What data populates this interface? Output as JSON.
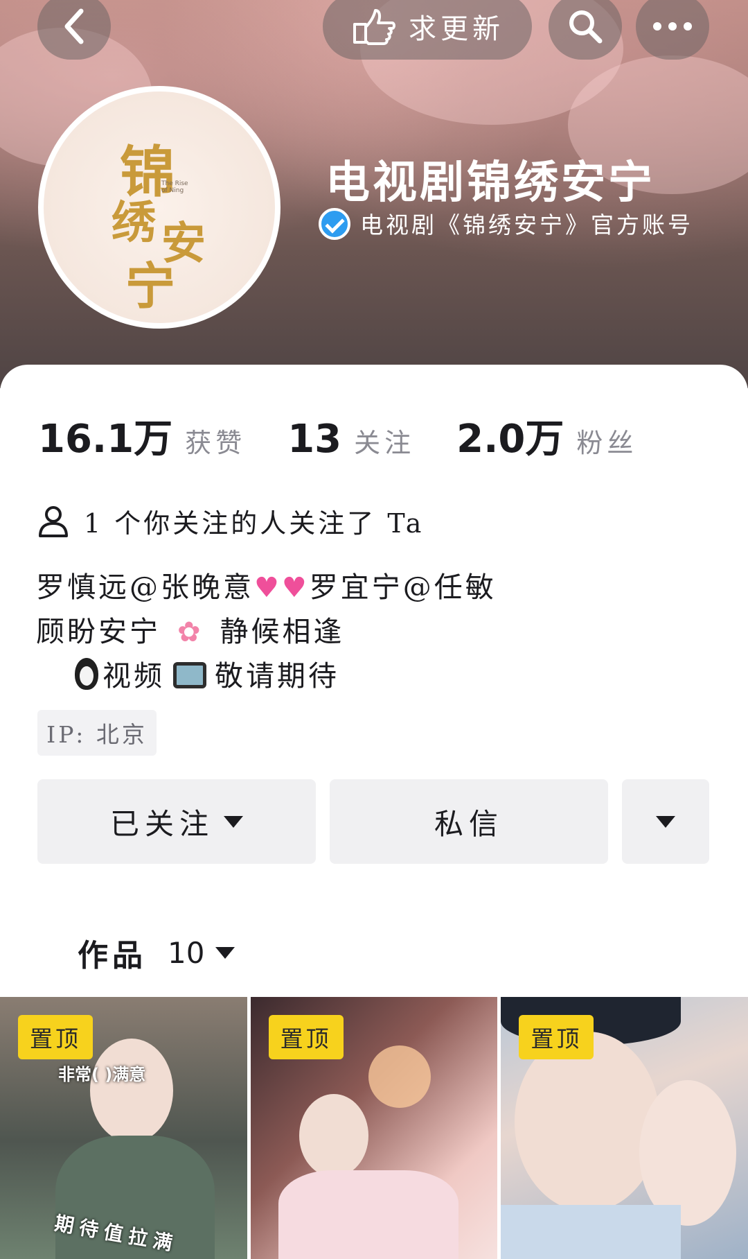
{
  "header": {
    "back_label": "‹",
    "update_label": "求更新",
    "search_label": "search",
    "more_label": "•••"
  },
  "profile": {
    "avatar_text": [
      "锦",
      "绣",
      "安",
      "宁"
    ],
    "avatar_caption": "The Rise of Ning",
    "name": "电视剧锦绣安宁",
    "verified_text": "电视剧《锦绣安宁》官方账号"
  },
  "stats": [
    {
      "value": "16.1万",
      "label": "获赞"
    },
    {
      "value": "13",
      "label": "关注"
    },
    {
      "value": "2.0万",
      "label": "粉丝"
    }
  ],
  "mutual": {
    "text": "1 个你关注的人关注了 Ta"
  },
  "bio": {
    "line1_a": "罗慎远@张晚意",
    "line1_b": "罗宜宁@任敏",
    "line2_a": "顾盼安宁",
    "line2_b": "静候相逢",
    "line3_a": "视频",
    "line3_b": "敬请期待"
  },
  "ip": "IP: 北京",
  "actions": {
    "follow_label": "已关注",
    "message_label": "私信"
  },
  "works": {
    "label": "作品",
    "count": "10"
  },
  "videos": [
    {
      "pin_label": "置顶",
      "caption_top": "非常(   )满意",
      "caption_bottom": "期待值拉满"
    },
    {
      "pin_label": "置顶"
    },
    {
      "pin_label": "置顶"
    }
  ],
  "colors": {
    "verify_blue": "#2d9cf0",
    "pin_yellow": "#f7d21d",
    "button_gray": "#f0f0f2"
  }
}
